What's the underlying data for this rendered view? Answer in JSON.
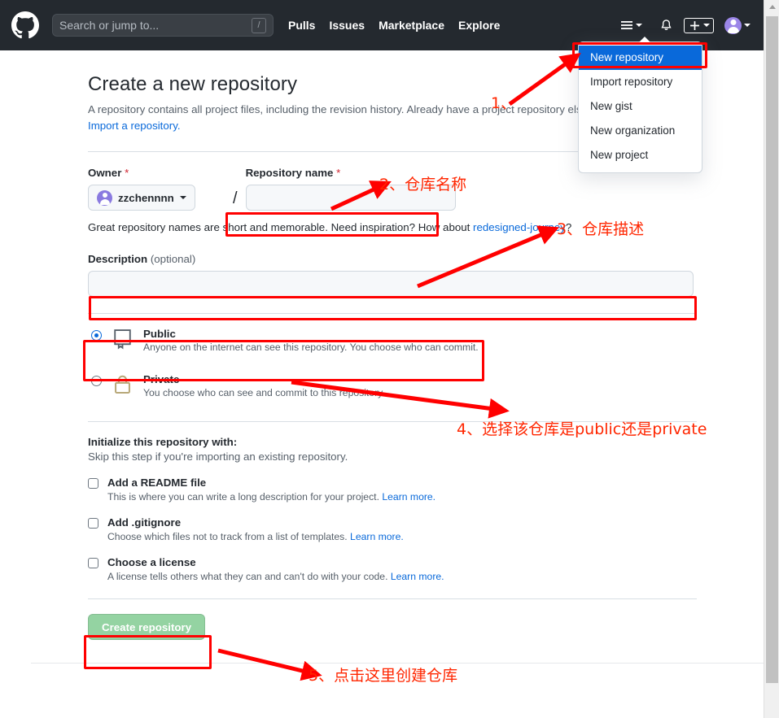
{
  "header": {
    "logo_icon": "github-logo-icon",
    "search": {
      "placeholder": "Search or jump to...",
      "shortcut_key": "/"
    },
    "nav": [
      {
        "label": "Pulls"
      },
      {
        "label": "Issues"
      },
      {
        "label": "Marketplace"
      },
      {
        "label": "Explore"
      }
    ],
    "icons": {
      "hamburger": "hamburger-menu-icon",
      "notifications": "bell-icon",
      "create_new": "plus-icon",
      "avatar": "user-avatar"
    },
    "background_color": "#24292f"
  },
  "dropdown": {
    "open": true,
    "items": [
      {
        "label": "New repository",
        "active": true
      },
      {
        "label": "Import repository",
        "active": false
      },
      {
        "label": "New gist",
        "active": false
      },
      {
        "label": "New organization",
        "active": false
      },
      {
        "label": "New project",
        "active": false
      }
    ],
    "active_color": "#0969da"
  },
  "main": {
    "title": "Create a new repository",
    "subtitle_before": "A repository contains all project files, including the revision history. Already have a project repository elsewhere?",
    "import_link": "Import a repository.",
    "owner": {
      "label": "Owner",
      "required_mark": "*",
      "value": "zzchennnn"
    },
    "repo_name": {
      "label": "Repository name",
      "required_mark": "*",
      "value": "",
      "placeholder": ""
    },
    "separator": "/",
    "suggestion_text_before": "Great repository names are short and memorable. Need inspiration? How about ",
    "suggestion_name": "redesigned-journey",
    "suggestion_text_after": "?",
    "description": {
      "label": "Description",
      "optional_label": "(optional)",
      "value": "",
      "placeholder": ""
    },
    "visibility": [
      {
        "id": "public",
        "title": "Public",
        "desc": "Anyone on the internet can see this repository. You choose who can commit.",
        "selected": true,
        "icon": "repo-book-icon"
      },
      {
        "id": "private",
        "title": "Private",
        "desc": "You choose who can see and commit to this repository.",
        "selected": false,
        "icon": "lock-icon"
      }
    ],
    "initialize": {
      "heading": "Initialize this repository with:",
      "subheading": "Skip this step if you're importing an existing repository.",
      "options": [
        {
          "title": "Add a README file",
          "desc": "This is where you can write a long description for your project.",
          "learn_more": "Learn more.",
          "checked": false
        },
        {
          "title": "Add .gitignore",
          "desc": "Choose which files not to track from a list of templates.",
          "learn_more": "Learn more.",
          "checked": false
        },
        {
          "title": "Choose a license",
          "desc": "A license tells others what they can and can't do with your code.",
          "learn_more": "Learn more.",
          "checked": false
        }
      ]
    },
    "create_button": {
      "label": "Create repository",
      "disabled": true,
      "color": "#94d3a2"
    }
  },
  "annotations": {
    "color": "#ff2600",
    "items": [
      {
        "id": "1",
        "text": "1、"
      },
      {
        "id": "2",
        "text": "2、仓库名称"
      },
      {
        "id": "3",
        "text": "3、仓库描述"
      },
      {
        "id": "4",
        "text": "4、选择该仓库是public还是private"
      },
      {
        "id": "5",
        "text": "5、点击这里创建仓库"
      }
    ]
  }
}
